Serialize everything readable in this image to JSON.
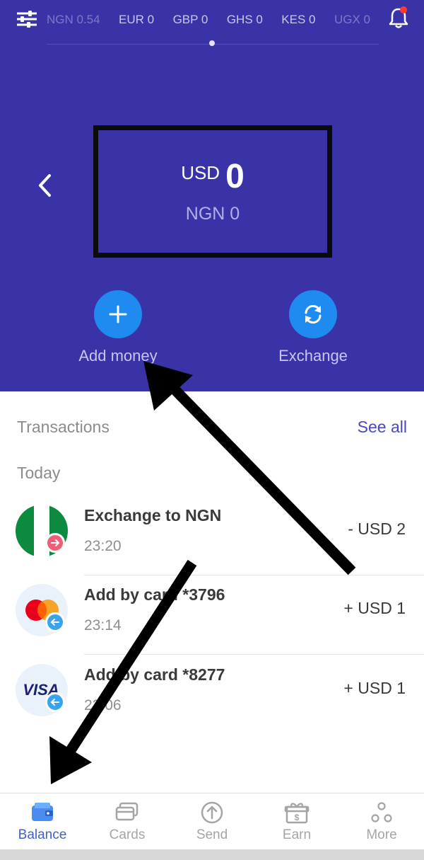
{
  "header": {
    "currencies": [
      "NGN 0.54",
      "EUR 0",
      "GBP 0",
      "GHS 0",
      "KES 0",
      "UGX 0",
      "U"
    ],
    "filter_icon": "sliders-icon",
    "notifications_icon": "bell-icon"
  },
  "balance": {
    "currency": "USD",
    "amount": "0",
    "secondary": "NGN 0"
  },
  "actions": {
    "add_money": "Add money",
    "exchange": "Exchange"
  },
  "transactions": {
    "title": "Transactions",
    "see_all": "See all",
    "group": "Today",
    "items": [
      {
        "name": "Exchange to NGN",
        "time": "23:20",
        "amount": "- USD 2",
        "icon": "nigeria-flag-icon"
      },
      {
        "name": "Add by card *3796",
        "time": "23:14",
        "amount": "+ USD 1",
        "icon": "mastercard-icon"
      },
      {
        "name": "Add by card *8277",
        "time": "22:06",
        "amount": "+ USD 1",
        "icon": "visa-icon"
      }
    ]
  },
  "nav": {
    "items": [
      {
        "label": "Balance",
        "icon": "wallet-icon",
        "active": true
      },
      {
        "label": "Cards",
        "icon": "cards-icon",
        "active": false
      },
      {
        "label": "Send",
        "icon": "send-icon",
        "active": false
      },
      {
        "label": "Earn",
        "icon": "gift-icon",
        "active": false
      },
      {
        "label": "More",
        "icon": "more-icon",
        "active": false
      }
    ]
  },
  "colors": {
    "header_bg": "#3a33a8",
    "accent": "#4a46c6",
    "action_blue": "#1f8af0",
    "nav_active": "#3f5fcb"
  },
  "visa_logo_text": "VISA"
}
